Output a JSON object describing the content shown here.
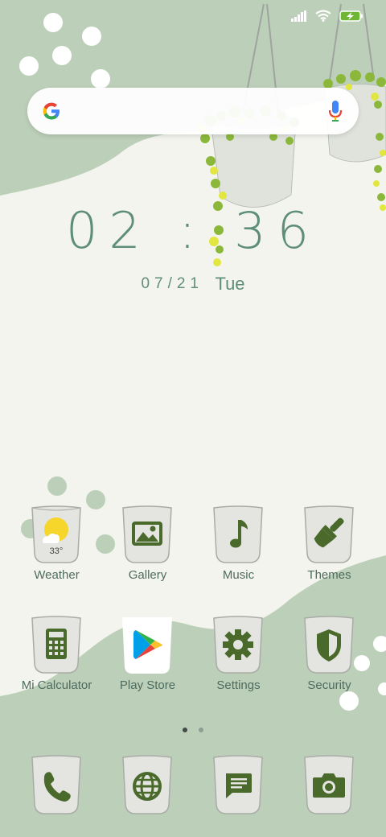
{
  "status_bar": {
    "icons": [
      "signal-icon",
      "wifi-icon",
      "battery-charging-icon"
    ]
  },
  "search": {
    "brand": "google-logo",
    "mic": "mic-icon",
    "placeholder": ""
  },
  "clock": {
    "time": "02 : 36",
    "date": "07/21",
    "weekday": "Tue"
  },
  "weather": {
    "temp": "33°"
  },
  "apps": [
    {
      "label": "Weather",
      "icon": "weather-icon"
    },
    {
      "label": "Gallery",
      "icon": "gallery-icon"
    },
    {
      "label": "Music",
      "icon": "music-icon"
    },
    {
      "label": "Themes",
      "icon": "themes-icon"
    },
    {
      "label": "Mi Calculator",
      "icon": "calculator-icon"
    },
    {
      "label": "Play Store",
      "icon": "play-store-icon"
    },
    {
      "label": "Settings",
      "icon": "settings-icon"
    },
    {
      "label": "Security",
      "icon": "security-icon"
    }
  ],
  "dock": [
    {
      "icon": "phone-icon"
    },
    {
      "icon": "browser-icon"
    },
    {
      "icon": "messages-icon"
    },
    {
      "icon": "camera-icon"
    }
  ],
  "pages": {
    "count": 2,
    "current": 1
  },
  "colors": {
    "background": "#f4f4ee",
    "blob_green": "#bccfb8",
    "icon_green": "#4a6a2c",
    "clock_text": "#5e8e7a",
    "label_text": "#4e6b5f"
  }
}
